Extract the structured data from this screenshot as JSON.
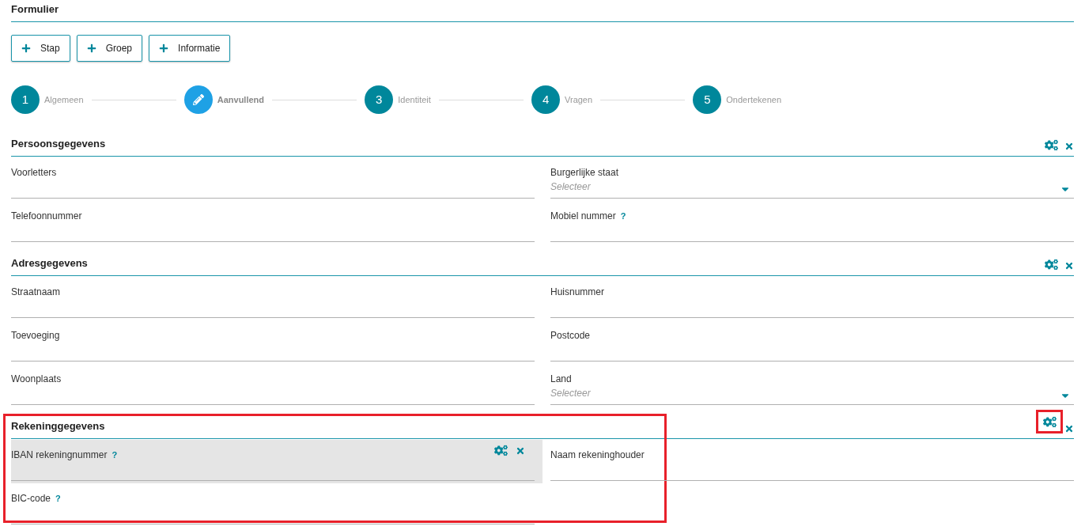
{
  "title": "Formulier",
  "buttons": [
    {
      "label": "Stap"
    },
    {
      "label": "Groep"
    },
    {
      "label": "Informatie"
    }
  ],
  "steps": [
    {
      "number": "1",
      "label": "Algemeen",
      "selected": false
    },
    {
      "label": "Aanvullend",
      "selected": true
    },
    {
      "number": "3",
      "label": "Identiteit",
      "selected": false
    },
    {
      "number": "4",
      "label": "Vragen",
      "selected": false
    },
    {
      "number": "5",
      "label": "Ondertekenen",
      "selected": false
    }
  ],
  "sections": [
    {
      "title": "Persoonsgegevens",
      "highlighted": false,
      "settings_highlighted": false,
      "fields": [
        {
          "kind": "text",
          "label": "Voorletters",
          "selected": false
        },
        {
          "kind": "select",
          "label": "Burgerlijke staat",
          "placeholder": "Selecteer",
          "selected": false
        },
        {
          "kind": "text",
          "label": "Telefoonnummer",
          "selected": false
        },
        {
          "kind": "text",
          "label": "Mobiel nummer",
          "help": "?",
          "selected": false
        }
      ]
    },
    {
      "title": "Adresgegevens",
      "highlighted": false,
      "settings_highlighted": false,
      "fields": [
        {
          "kind": "text",
          "label": "Straatnaam",
          "selected": false
        },
        {
          "kind": "text",
          "label": "Huisnummer",
          "selected": false
        },
        {
          "kind": "text",
          "label": "Toevoeging",
          "selected": false
        },
        {
          "kind": "text",
          "label": "Postcode",
          "selected": false
        },
        {
          "kind": "text",
          "label": "Woonplaats",
          "selected": false
        },
        {
          "kind": "select",
          "label": "Land",
          "placeholder": "Selecteer",
          "selected": false
        }
      ]
    },
    {
      "title": "Rekeninggegevens",
      "highlighted": true,
      "settings_highlighted": true,
      "fields": [
        {
          "kind": "text",
          "label": "IBAN rekeningnummer",
          "help": "?",
          "selected": true
        },
        {
          "kind": "text",
          "label": "Naam rekeninghouder",
          "selected": false
        },
        {
          "kind": "text",
          "label": "BIC-code",
          "help": "?",
          "selected": false
        }
      ]
    }
  ]
}
